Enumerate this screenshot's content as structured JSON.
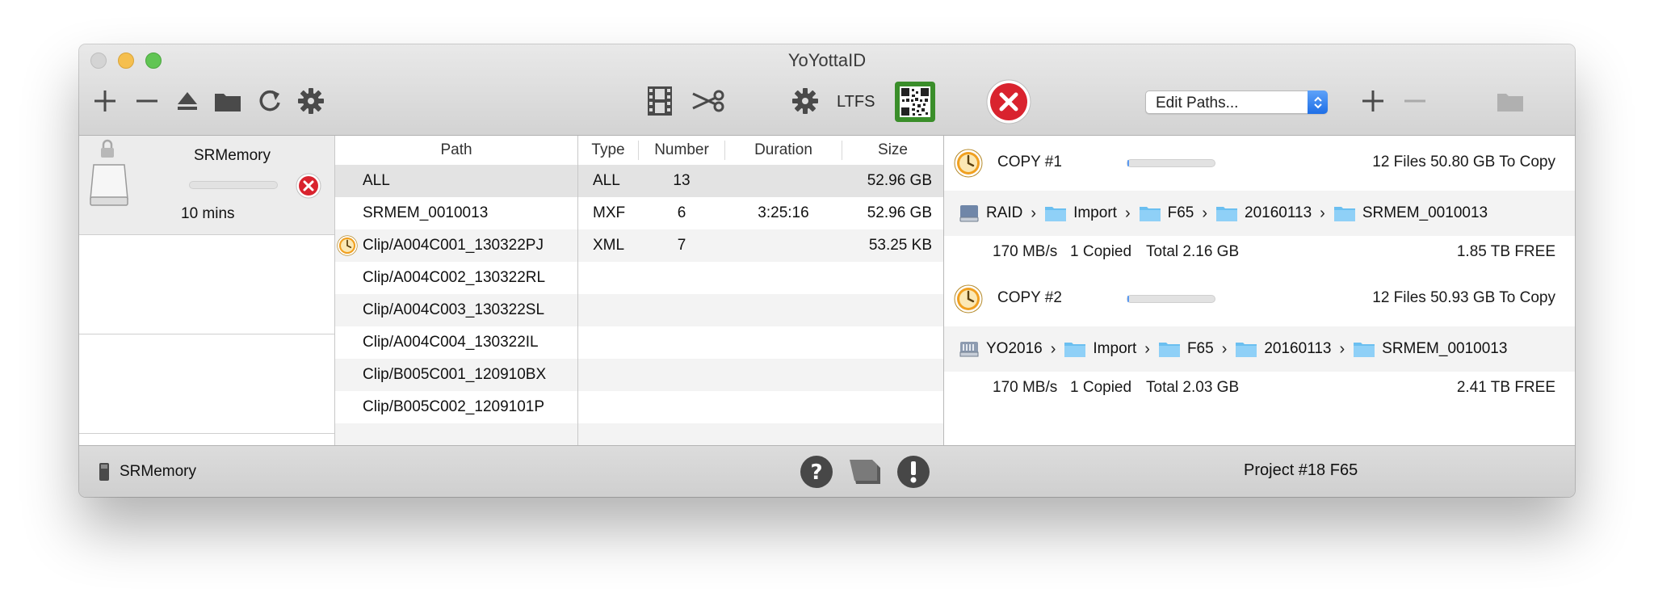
{
  "window": {
    "title": "YoYottaID"
  },
  "toolbar": {
    "ltfs_label": "LTFS",
    "edit_paths_label": "Edit Paths..."
  },
  "device": {
    "name": "SRMemory",
    "time_left": "10 mins",
    "progress": 0.0
  },
  "paths": {
    "header": "Path",
    "items": [
      {
        "label": "ALL",
        "status": ""
      },
      {
        "label": "SRMEM_0010013",
        "status": ""
      },
      {
        "label": "Clip/A004C001_130322PJ",
        "status": "clock-icon"
      },
      {
        "label": "Clip/A004C002_130322RL",
        "status": ""
      },
      {
        "label": "Clip/A004C003_130322SL",
        "status": ""
      },
      {
        "label": "Clip/A004C004_130322IL",
        "status": ""
      },
      {
        "label": "Clip/B005C001_120910BX",
        "status": ""
      },
      {
        "label": "Clip/B005C002_1209101P",
        "status": ""
      }
    ]
  },
  "file_table": {
    "headers": {
      "type": "Type",
      "number": "Number",
      "duration": "Duration",
      "size": "Size"
    },
    "rows": [
      {
        "type": "ALL",
        "number": "13",
        "duration": "",
        "size": "52.96 GB"
      },
      {
        "type": "MXF",
        "number": "6",
        "duration": "3:25:16",
        "size": "52.96 GB"
      },
      {
        "type": "XML",
        "number": "7",
        "duration": "",
        "size": "53.25 KB"
      }
    ]
  },
  "copies": [
    {
      "title": "COPY #1",
      "progress": 0.01,
      "summary": "12 Files 50.80 GB To Copy",
      "path": [
        "RAID",
        "Import",
        "F65",
        "20160113",
        "SRMEM_0010013"
      ],
      "speed": "170 MB/s",
      "copied": "1 Copied",
      "total": "Total 2.16 GB",
      "free": "1.85 TB FREE"
    },
    {
      "title": "COPY #2",
      "progress": 0.01,
      "summary": "12 Files 50.93 GB To Copy",
      "path": [
        "YO2016",
        "Import",
        "F65",
        "20160113",
        "SRMEM_0010013"
      ],
      "speed": "170 MB/s",
      "copied": "1 Copied",
      "total": "Total 2.03 GB",
      "free": "2.41 TB FREE"
    }
  ],
  "statusbar": {
    "device_label": "SRMemory",
    "project": "Project #18 F65"
  },
  "colors": {
    "accent_blue": "#2f7cf0",
    "stop_red": "#d9232e",
    "clock_orange": "#f0a020",
    "qr_green": "#3a8e2a"
  }
}
